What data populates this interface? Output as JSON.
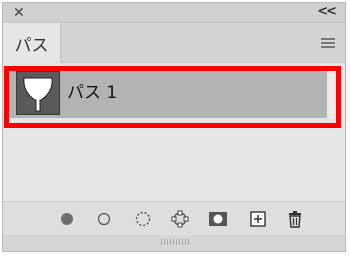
{
  "header": {
    "close_glyph": "✕",
    "collapse_glyph": "<<"
  },
  "tabs": [
    {
      "label": "パス"
    }
  ],
  "paths": [
    {
      "label": "パス 1",
      "selected": true
    }
  ],
  "toolbar": {
    "buttons": [
      "fill-path-icon",
      "stroke-path-icon",
      "load-as-selection-icon",
      "make-work-path-icon",
      "add-mask-icon",
      "new-path-icon",
      "delete-path-icon"
    ]
  },
  "colors": {
    "highlight": "#ff0000",
    "selected_row": "#b3b3b3",
    "panel_bg": "#e6e6e6"
  }
}
